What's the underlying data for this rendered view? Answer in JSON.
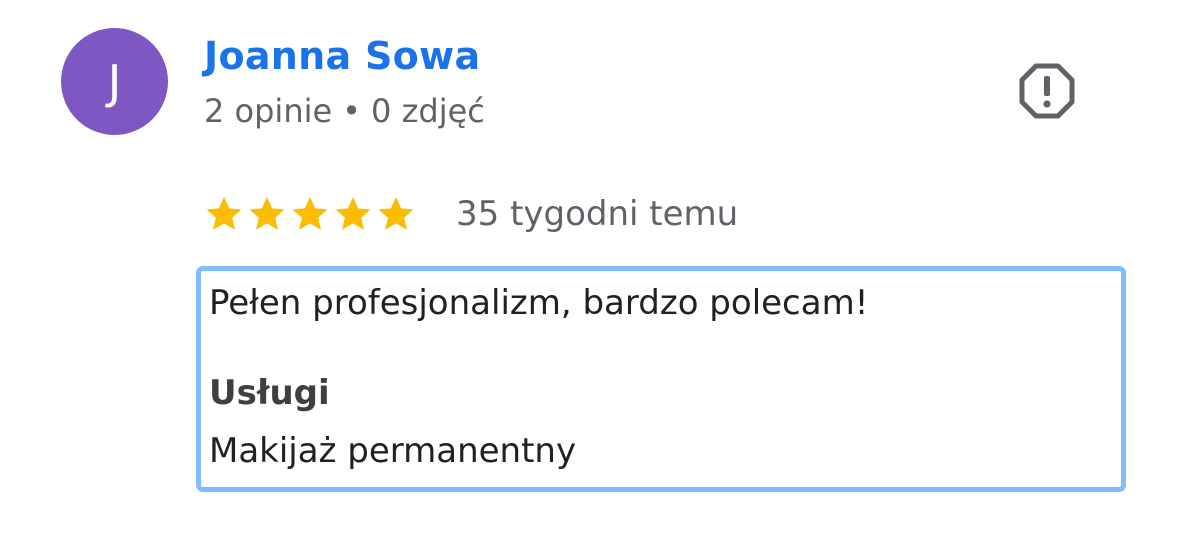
{
  "author": {
    "avatar_initial": "J",
    "avatar_color": "#7e57c2",
    "name": "Joanna Sowa",
    "name_color": "#1a73e8",
    "reviews_count": "2 opinie",
    "separator": "•",
    "photos_count": "0 zdjęć"
  },
  "report": {
    "icon": "report-flag-octagon-icon"
  },
  "rating": {
    "stars": 5,
    "max_stars": 5,
    "star_color": "#fbbc04",
    "time_ago": "35 tygodni temu"
  },
  "review": {
    "text": "Pełen profesjonalizm, bardzo polecam!",
    "service_label": "Usługi",
    "service_value": "Makijaż permanentny",
    "highlight_color": "#80bdfc"
  }
}
